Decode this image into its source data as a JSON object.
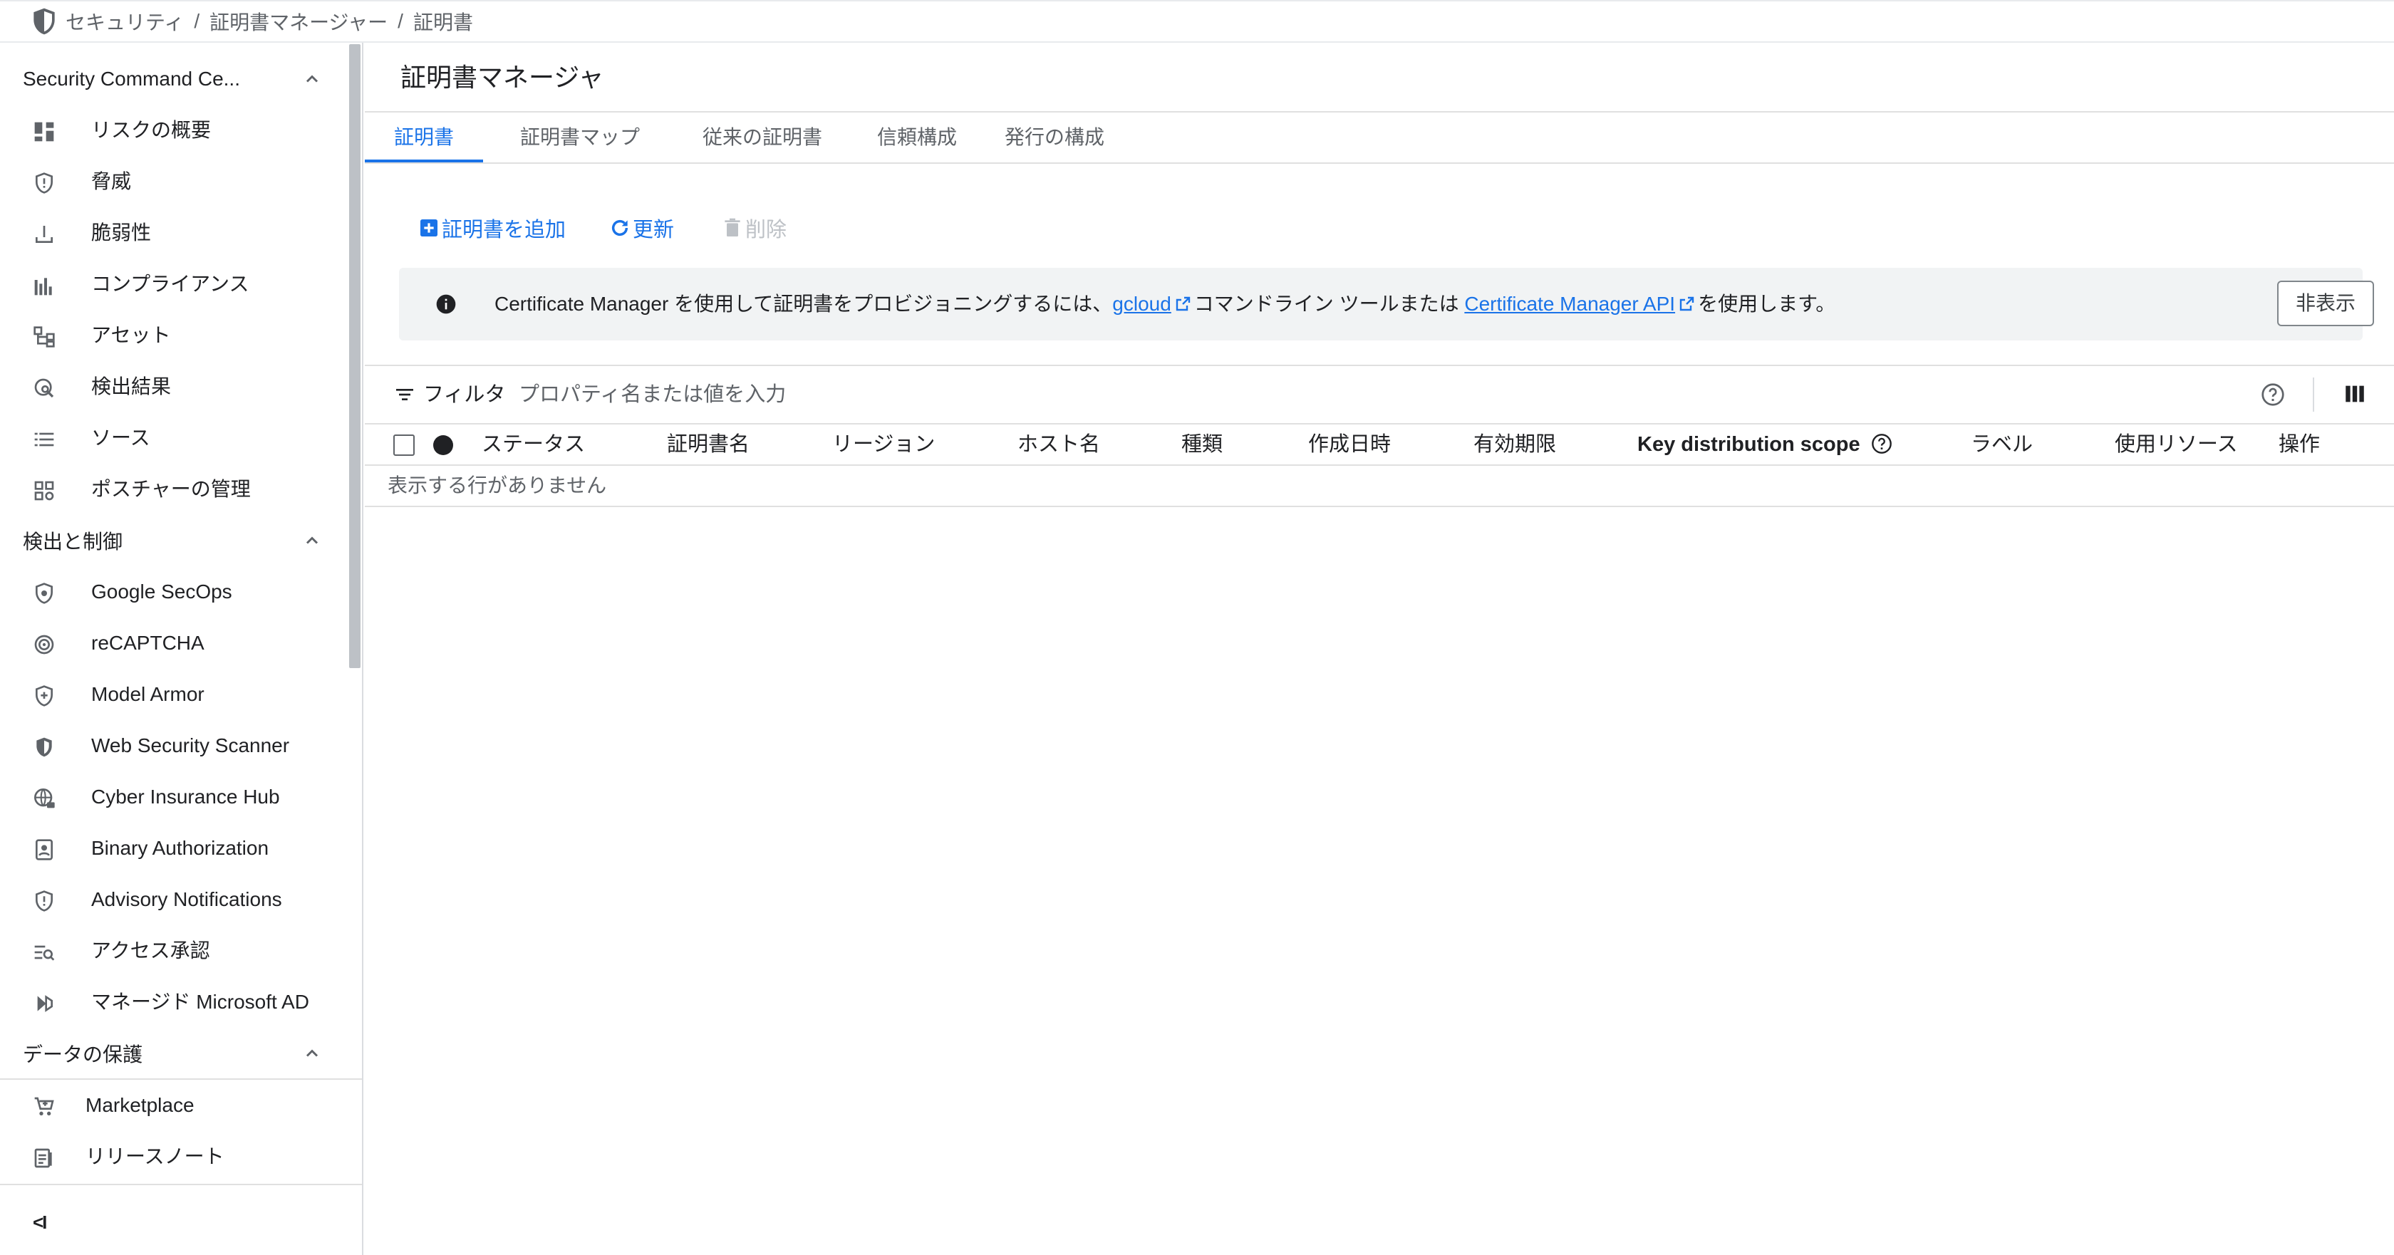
{
  "breadcrumb": {
    "items": [
      "セキュリティ",
      "証明書マネージャー",
      "証明書"
    ],
    "separator": "/"
  },
  "sidebar": {
    "sections": [
      {
        "title": "Security Command Ce...",
        "items": [
          {
            "label": "リスクの概要",
            "icon": "dashboard-icon"
          },
          {
            "label": "脅威",
            "icon": "shield-alert-icon"
          },
          {
            "label": "脆弱性",
            "icon": "download-bar-icon"
          },
          {
            "label": "コンプライアンス",
            "icon": "bar-chart-icon"
          },
          {
            "label": "アセット",
            "icon": "hierarchy-icon"
          },
          {
            "label": "検出結果",
            "icon": "radar-search-icon"
          },
          {
            "label": "ソース",
            "icon": "list-icon"
          },
          {
            "label": "ポスチャーの管理",
            "icon": "grid-settings-icon"
          }
        ]
      },
      {
        "title": "検出と制御",
        "items": [
          {
            "label": "Google SecOps",
            "icon": "shield-icon"
          },
          {
            "label": "reCAPTCHA",
            "icon": "recaptcha-icon"
          },
          {
            "label": "Model Armor",
            "icon": "shield-plus-icon"
          },
          {
            "label": "Web Security Scanner",
            "icon": "shield-filled-icon"
          },
          {
            "label": "Cyber Insurance Hub",
            "icon": "globe-lock-icon"
          },
          {
            "label": "Binary Authorization",
            "icon": "badge-person-icon"
          },
          {
            "label": "Advisory Notifications",
            "icon": "shield-exclamation-icon"
          },
          {
            "label": "アクセス承認",
            "icon": "list-search-icon"
          },
          {
            "label": "マネージド Microsoft AD",
            "icon": "microsoft-ad-icon"
          }
        ]
      },
      {
        "title": "データの保護",
        "items": []
      }
    ],
    "footer_items": [
      {
        "label": "Marketplace",
        "icon": "cart-icon"
      },
      {
        "label": "リリースノート",
        "icon": "release-notes-icon"
      }
    ],
    "collapse_glyph": "<I"
  },
  "main": {
    "title": "証明書マネージャ",
    "tabs": [
      "証明書",
      "証明書マップ",
      "従来の証明書",
      "信頼構成",
      "発行の構成"
    ],
    "active_tab": 0,
    "toolbar": {
      "add_label": "証明書を追加",
      "refresh_label": "更新",
      "delete_label": "削除"
    },
    "banner": {
      "text_before": "Certificate Manager を使用して証明書をプロビジョニングするには、",
      "link1": "gcloud",
      "text_middle": "コマンドライン ツールまたは",
      "link2": "Certificate Manager API",
      "text_after": "を使用します。",
      "hide_label": "非表示"
    },
    "filter": {
      "label": "フィルタ",
      "placeholder": "プロパティ名または値を入力"
    },
    "table": {
      "columns": [
        "ステータス",
        "証明書名",
        "リージョン",
        "ホスト名",
        "種類",
        "作成日時",
        "有効期限",
        "Key distribution scope",
        "ラベル",
        "使用リソース",
        "操作"
      ],
      "empty_text": "表示する行がありません"
    }
  },
  "colors": {
    "accent": "#1a73e8",
    "banner_bg": "#f1f3f4",
    "text": "#202124",
    "muted": "#5f6368",
    "disabled": "#bdc1c6"
  }
}
